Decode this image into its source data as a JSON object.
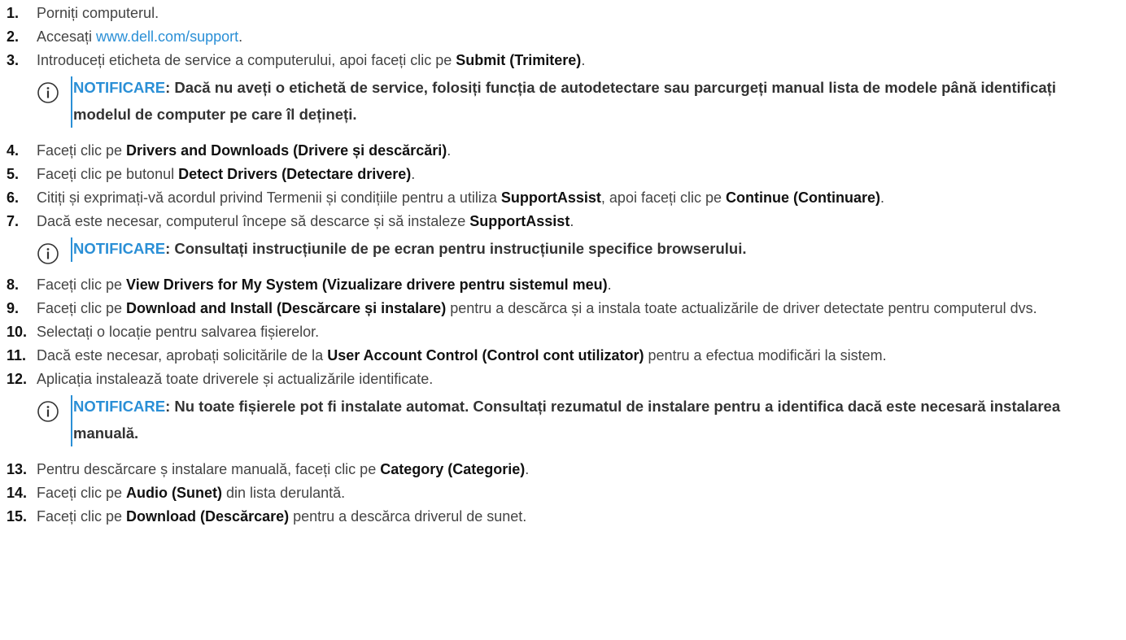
{
  "steps": [
    {
      "num": "1.",
      "parts": [
        {
          "t": "Porniți computerul."
        }
      ]
    },
    {
      "num": "2.",
      "parts": [
        {
          "t": "Accesați "
        },
        {
          "t": "www.dell.com/support",
          "link": true
        },
        {
          "t": "."
        }
      ]
    },
    {
      "num": "3.",
      "parts": [
        {
          "t": "Introduceți eticheta de service a computerului, apoi faceți clic pe "
        },
        {
          "t": "Submit (Trimitere)",
          "b": true
        },
        {
          "t": "."
        }
      ]
    },
    {
      "num": "4.",
      "parts": [
        {
          "t": "Faceți clic pe "
        },
        {
          "t": "Drivers and Downloads (Drivere și descărcări)",
          "b": true
        },
        {
          "t": "."
        }
      ]
    },
    {
      "num": "5.",
      "parts": [
        {
          "t": "Faceți clic pe butonul "
        },
        {
          "t": "Detect Drivers (Detectare drivere)",
          "b": true
        },
        {
          "t": "."
        }
      ]
    },
    {
      "num": "6.",
      "parts": [
        {
          "t": "Citiți și exprimați-vă acordul privind Termenii și condițiile pentru a utiliza "
        },
        {
          "t": "SupportAssist",
          "b": true
        },
        {
          "t": ", apoi faceți clic pe "
        },
        {
          "t": "Continue (Continuare)",
          "b": true
        },
        {
          "t": "."
        }
      ]
    },
    {
      "num": "7.",
      "parts": [
        {
          "t": "Dacă este necesar, computerul începe să descarce și să instaleze "
        },
        {
          "t": "SupportAssist",
          "b": true
        },
        {
          "t": "."
        }
      ]
    },
    {
      "num": "8.",
      "parts": [
        {
          "t": "Faceți clic pe "
        },
        {
          "t": "View Drivers for My System (Vizualizare drivere pentru sistemul meu)",
          "b": true
        },
        {
          "t": "."
        }
      ]
    },
    {
      "num": "9.",
      "parts": [
        {
          "t": "Faceți clic pe "
        },
        {
          "t": "Download and Install (Descărcare și instalare)",
          "b": true
        },
        {
          "t": " pentru a descărca și a instala toate actualizările de driver detectate pentru computerul dvs."
        }
      ]
    },
    {
      "num": "10.",
      "parts": [
        {
          "t": "Selectați o locație pentru salvarea fișierelor."
        }
      ]
    },
    {
      "num": "11.",
      "parts": [
        {
          "t": "Dacă este necesar, aprobați solicitările de la "
        },
        {
          "t": "User Account Control (Control cont utilizator)",
          "b": true
        },
        {
          "t": " pentru a efectua modificări la sistem."
        }
      ]
    },
    {
      "num": "12.",
      "parts": [
        {
          "t": "Aplicația instalează toate driverele și actualizările identificate."
        }
      ]
    },
    {
      "num": "13.",
      "parts": [
        {
          "t": "Pentru descărcare ș instalare manuală, faceți clic pe "
        },
        {
          "t": "Category (Categorie)",
          "b": true
        },
        {
          "t": "."
        }
      ]
    },
    {
      "num": "14.",
      "parts": [
        {
          "t": "Faceți clic pe "
        },
        {
          "t": "Audio (Sunet)",
          "b": true
        },
        {
          "t": " din lista derulantă."
        }
      ]
    },
    {
      "num": "15.",
      "parts": [
        {
          "t": "Faceți clic pe "
        },
        {
          "t": "Download (Descărcare)",
          "b": true
        },
        {
          "t": " pentru a descărca driverul de sunet."
        }
      ]
    }
  ],
  "notes": [
    {
      "after_step": "3.",
      "label": "NOTIFICARE",
      "text": ": Dacă nu aveți o etichetă de service, folosiți funcția de autodetectare sau parcurgeți manual lista de modele până identificați modelul de computer pe care îl dețineți."
    },
    {
      "after_step": "7.",
      "label": "NOTIFICARE",
      "text": ": Consultați instrucțiunile de pe ecran pentru instrucțiunile specifice browserului."
    },
    {
      "after_step": "12.",
      "label": "NOTIFICARE",
      "text": ": Nu toate fișierele pot fi instalate automat. Consultați rezumatul de instalare pentru a identifica dacă este necesară instalarea manuală."
    }
  ],
  "colors": {
    "link": "#2a8fd6",
    "note_accent": "#2a8fd6",
    "text": "#444444",
    "bold": "#111111"
  },
  "icons": {
    "note": "info-circle-icon"
  }
}
